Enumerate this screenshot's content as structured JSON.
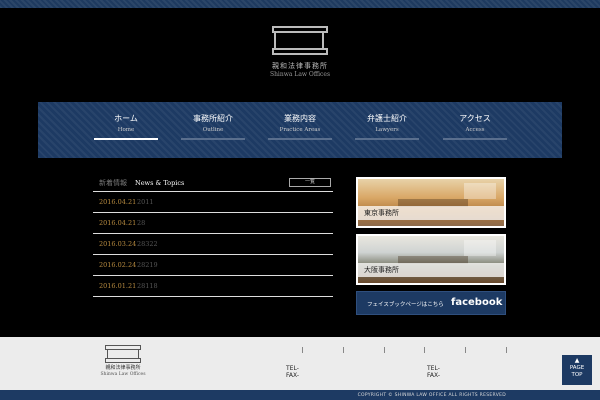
{
  "brand": {
    "name_jp": "親和法律事務所",
    "name_en": "Shinwa Law Offices"
  },
  "nav": [
    {
      "jp": "ホーム",
      "en": "Home",
      "active": true
    },
    {
      "jp": "事務所紹介",
      "en": "Outline",
      "active": false
    },
    {
      "jp": "業務内容",
      "en": "Practice Areas",
      "active": false
    },
    {
      "jp": "弁護士紹介",
      "en": "Lawyers",
      "active": false
    },
    {
      "jp": "アクセス",
      "en": "Access",
      "active": false
    }
  ],
  "news": {
    "heading_jp": "新着情報",
    "heading_en": "News & Topics",
    "more_label": "一覧",
    "items": [
      {
        "date": "2016.04.21",
        "title": "2011"
      },
      {
        "date": "2016.04.21",
        "title": "28"
      },
      {
        "date": "2016.03.24",
        "title": "28322"
      },
      {
        "date": "2016.02.24",
        "title": "28219"
      },
      {
        "date": "2016.01.21",
        "title": "28118"
      }
    ]
  },
  "offices": {
    "tokyo": "東京事務所",
    "osaka": "大阪事務所"
  },
  "facebook": {
    "text": "フェイスブックページはこちら",
    "logo": "facebook"
  },
  "footer": {
    "name_jp": "親和法律事務所",
    "name_en": "Shinwa Law Offices",
    "tel1": "TEL-",
    "fax1": "FAX-",
    "tel2": "TEL-",
    "fax2": "FAX-",
    "copyright": "COPYRIGHT © SHINWA LAW OFFICE ALL RIGHTS RESERVED"
  },
  "pagetop": {
    "arrow": "▲",
    "line1": "PAGE",
    "line2": "TOP"
  },
  "colors": {
    "navy": "#1d3a63",
    "date_gold": "#b5893f"
  }
}
